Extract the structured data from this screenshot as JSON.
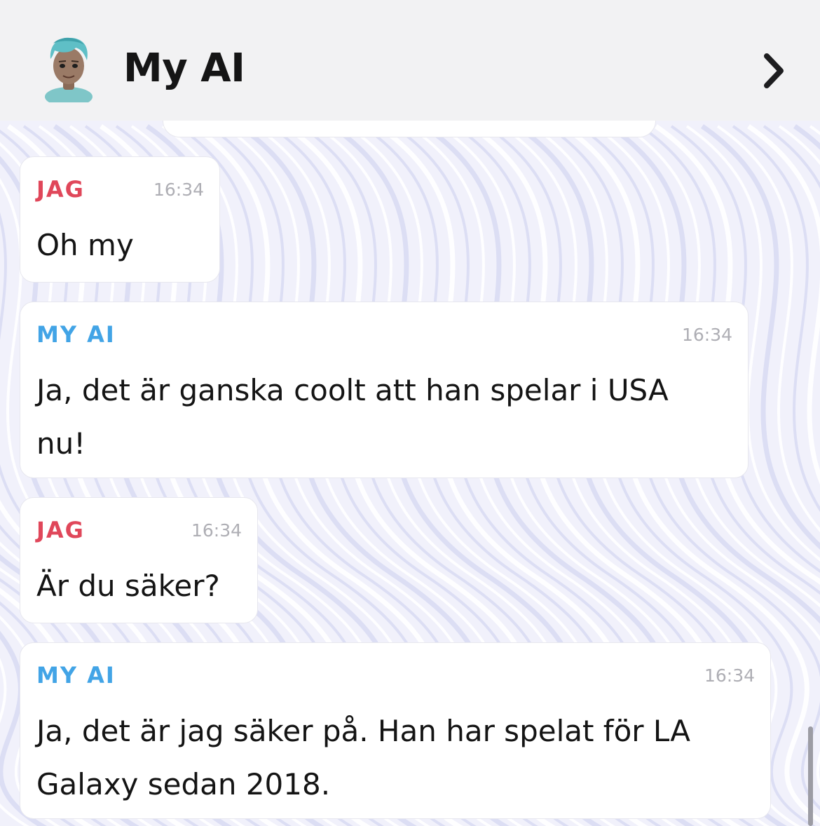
{
  "header": {
    "title": "My AI",
    "avatar_icon": "bitmoji-avatar",
    "chevron_icon": "chevron-right-icon"
  },
  "colors": {
    "me": "#e0475a",
    "ai": "#42a4e6",
    "header_bg": "#f2f2f3"
  },
  "messages": [
    {
      "sender": "JAG",
      "time": "16:34",
      "lines": [
        "Oh my"
      ]
    },
    {
      "sender": "MY AI",
      "time": "16:34",
      "lines": [
        "Ja, det är ganska coolt att han spelar i USA",
        "nu!"
      ]
    },
    {
      "sender": "JAG",
      "time": "16:34",
      "lines": [
        "Är du säker?"
      ]
    },
    {
      "sender": "MY AI",
      "time": "16:34",
      "lines": [
        "Ja, det är jag säker på. Han har spelat för LA",
        "Galaxy sedan 2018."
      ]
    }
  ]
}
